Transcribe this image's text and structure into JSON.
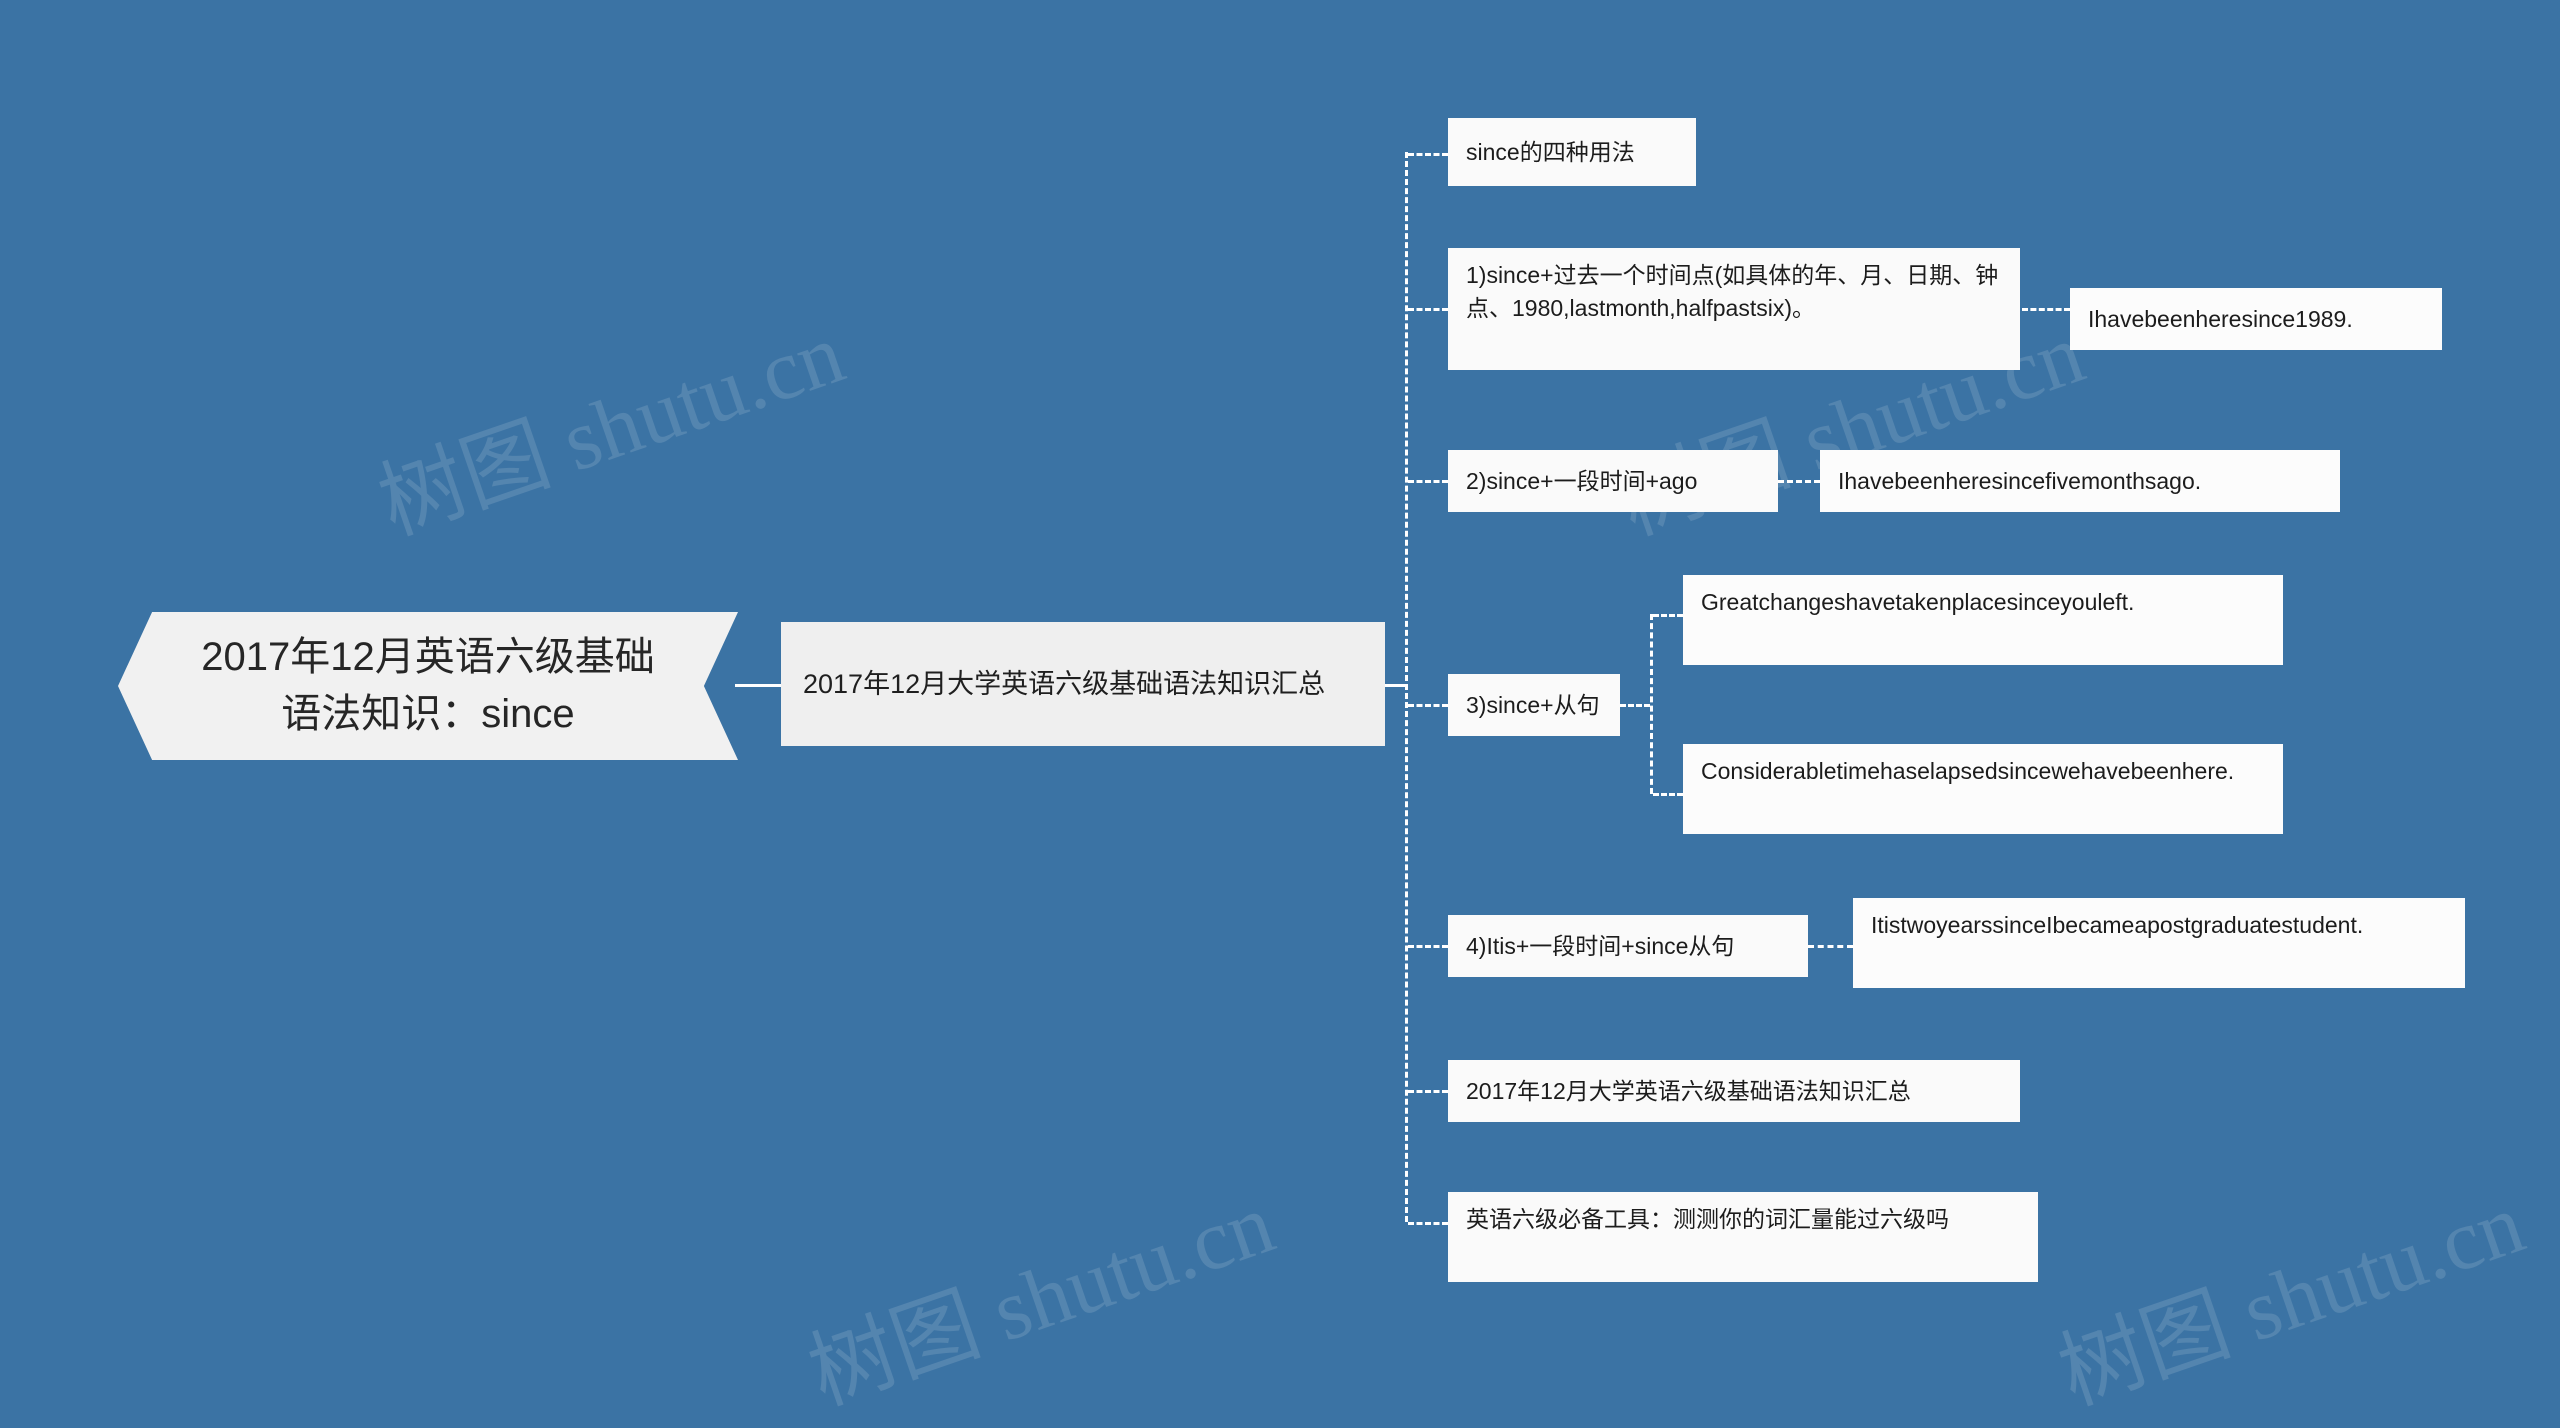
{
  "background_color": "#3b73a4",
  "node_color": "#f1f1f1",
  "connector_color": "#ffffff",
  "watermark": {
    "text": "树图 shutu.cn",
    "instances": 4
  },
  "mindmap": {
    "type": "mindmap",
    "root": {
      "label": "2017年12月英语六级基础语法知识：since",
      "line1": "2017年12月英语六级基础",
      "line2": "语法知识：since"
    },
    "level2": {
      "label": "2017年12月大学英语六级基础语法知识汇总"
    },
    "branches": [
      {
        "id": "branch-1",
        "label": "since的四种用法",
        "children": []
      },
      {
        "id": "branch-2",
        "label": "1)since+过去一个时间点(如具体的年、月、日期、钟点、1980,lastmonth,halfpastsix)。",
        "children": [
          {
            "id": "branch-2-child-1",
            "label": "Ihavebeenheresince1989."
          }
        ]
      },
      {
        "id": "branch-3",
        "label": "2)since+一段时间+ago",
        "children": [
          {
            "id": "branch-3-child-1",
            "label": "Ihavebeenheresincefivemonthsago."
          }
        ]
      },
      {
        "id": "branch-4",
        "label": "3)since+从句",
        "children": [
          {
            "id": "branch-4-child-1",
            "label": "Greatchangeshavetakenplacesinceyouleft."
          },
          {
            "id": "branch-4-child-2",
            "label": "Considerabletimehaselapsedsincewehavebeenhere."
          }
        ]
      },
      {
        "id": "branch-5",
        "label": "4)Itis+一段时间+since从句",
        "children": [
          {
            "id": "branch-5-child-1",
            "label": "ItistwoyearssinceIbecameapostgraduatestudent."
          }
        ]
      },
      {
        "id": "branch-6",
        "label": "2017年12月大学英语六级基础语法知识汇总",
        "children": []
      },
      {
        "id": "branch-7",
        "label": "英语六级必备工具：测测你的词汇量能过六级吗",
        "children": []
      }
    ]
  }
}
